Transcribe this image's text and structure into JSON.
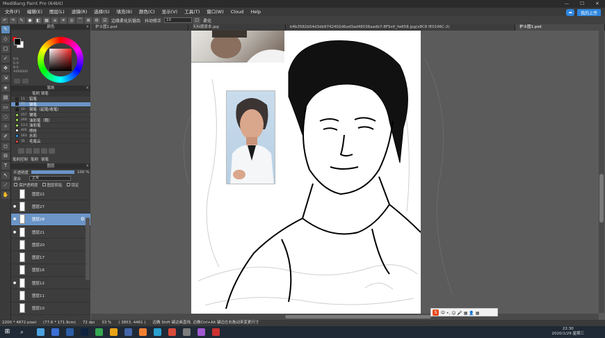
{
  "window": {
    "title": "MediBang Paint Pro (64bit)",
    "controls": [
      "—",
      "☐",
      "✕"
    ]
  },
  "menu": [
    "文件(F)",
    "编辑(E)",
    "图层(L)",
    "滤镜(R)",
    "选择(S)",
    "填充(B)",
    "颜色(C)",
    "显示(V)",
    "工具(T)",
    "窗口(W)",
    "Cloud",
    "Help"
  ],
  "cloud": {
    "label": "我的上传"
  },
  "toolbar": {
    "aa_label": "边缘柔化抗锯齿",
    "correction_label": "抖动修正",
    "correction_value": "10",
    "soft_label": "柔化"
  },
  "tabs": [
    "护士图1.psd",
    "无标题原本.jpg",
    "b4b3582b54d3db9742402d6ad3ad48036aadb7-8FSxIf_fw658.jpg(x8C8 IE0196C-2)",
    "护士图1.psd"
  ],
  "color_panel": {
    "title": "颜色",
    "values": "R:0\nG:0\nB:0\n#000000"
  },
  "brush_panel": {
    "title": "笔刷",
    "subtabs": "笔刷  钢笔",
    "items": [
      {
        "size": "11",
        "name": "铅笔",
        "color": "#2b2b2b"
      },
      {
        "size": "10",
        "name": "钢笔",
        "color": "#1f1f1f"
      },
      {
        "size": "10",
        "name": "钢笔（起笔/收笔）",
        "color": "#1f1f1f"
      },
      {
        "size": "257",
        "name": "铺笔",
        "color": "#9bd14a"
      },
      {
        "size": "260",
        "name": "油彩笔（稠）",
        "color": "#9bd14a"
      },
      {
        "size": "13.1",
        "name": "油彩笔",
        "color": "#9bd14a"
      },
      {
        "size": "405",
        "name": "喷枪",
        "color": "#e0e0e0"
      },
      {
        "size": "163",
        "name": "水彩",
        "color": "#2f8fd6"
      },
      {
        "size": "35",
        "name": "毛笔云",
        "color": "#d04040"
      }
    ],
    "bottom_tabs": [
      "笔刷控制",
      "笔刷",
      "钢笔"
    ]
  },
  "layer_panel": {
    "title": "图层",
    "opacity_label": "不透明度",
    "opacity_value": "100 %",
    "blend_label": "混合",
    "blend_value": "正常",
    "protect_label": "保护透明度",
    "clip_label": "图层剪贴",
    "lock_label": "锁定",
    "layers": [
      {
        "name": "图层22",
        "visible": false,
        "selected": false
      },
      {
        "name": "图层27",
        "visible": true,
        "selected": false
      },
      {
        "name": "图层28",
        "visible": true,
        "selected": true
      },
      {
        "name": "图层21",
        "visible": true,
        "selected": false
      },
      {
        "name": "图层20",
        "visible": false,
        "selected": false
      },
      {
        "name": "图层17",
        "visible": false,
        "selected": false
      },
      {
        "name": "图层16",
        "visible": false,
        "selected": false
      },
      {
        "name": "图层12",
        "visible": true,
        "selected": false
      },
      {
        "name": "图层11",
        "visible": false,
        "selected": false
      },
      {
        "name": "图层10",
        "visible": false,
        "selected": false
      }
    ]
  },
  "status": {
    "size": "2200 * 4872 pixel",
    "physical": "(77.6 * 171.9cm)",
    "dpi": "72 dpi",
    "zoom": "33 %",
    "coords": "( 3853, 4461 )",
    "hint": "边做 Shift 键边画直线. 边做Ctrl+Alt 键边左右拖动来变更尺寸"
  },
  "taskbar": {
    "time": "22:30",
    "date": "2020/1/29 星期三",
    "apps": [
      "#4aa3df",
      "#3b6fd4",
      "#2c5fa8",
      "#0d2340",
      "#35a852",
      "#e8a317",
      "#4466aa",
      "#f08030",
      "#2aa0d0",
      "#d84a3a",
      "#7c7c7c",
      "#a05ad0",
      "#cc3333"
    ]
  },
  "ime": {
    "icon": "S",
    "label": "中 •, ☺ 🎤 ▦ 👤 ▦"
  }
}
